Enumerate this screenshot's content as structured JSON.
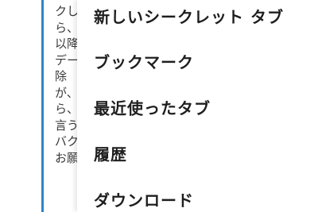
{
  "article": {
    "lines": [
      "クし",
      "ら、",
      "以降",
      "デー",
      "除 ",
      "が、",
      "ら、",
      "言う",
      "バク",
      "お願"
    ]
  },
  "menu": {
    "items": [
      {
        "label": "新しいシークレット タブ"
      },
      {
        "label": "ブックマーク"
      },
      {
        "label": "最近使ったタブ"
      },
      {
        "label": "履歴"
      },
      {
        "label": "ダウンロード"
      }
    ]
  },
  "colors": {
    "accent": "#2e86c8",
    "menu_text": "#1e1e1e",
    "article_text": "#3a3a3a",
    "background": "#ffffff"
  }
}
